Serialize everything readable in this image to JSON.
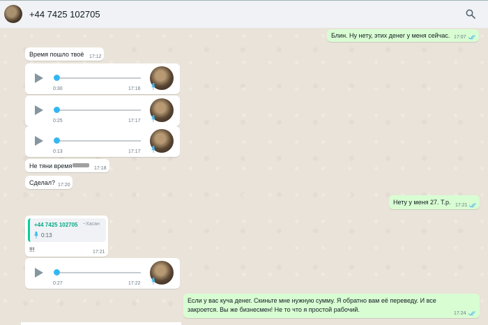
{
  "header": {
    "contact": "+44 7425 102705",
    "search_icon": "search-icon"
  },
  "colors": {
    "incoming": "#ffffff",
    "outgoing": "#d9fdd3",
    "read_ticks": "#53bdeb",
    "quote_bar": "#06cf9c"
  },
  "messages": {
    "m1": {
      "text": "Блин. Ну нету, этих денег у меня сейчас.",
      "time": "17:07"
    },
    "m2": {
      "text": "Время пошло твоё",
      "time": "17:12"
    },
    "v1": {
      "duration": "0:30",
      "time": "17:16"
    },
    "v2": {
      "duration": "0:25",
      "time": "17:17"
    },
    "v3": {
      "duration": "0:13",
      "time": "17:17"
    },
    "m3": {
      "text": "Не тяни время",
      "time": "17:18"
    },
    "m4": {
      "text": "Сделал?",
      "time": "17:20"
    },
    "m5": {
      "text": "Нету у меня 27. Т.р.",
      "time": "17:21"
    },
    "q1": {
      "quote_name": "+44 7425 102705",
      "quote_alias": "~Хасан",
      "quote_duration": "0:13",
      "text": "!!!",
      "time": "17:21"
    },
    "v4": {
      "duration": "0:27",
      "time": "17:22"
    },
    "m6": {
      "line1": "Если у вас куча денег. Скиньте мне нужную сумму. Я обратно вам её переведу. И все",
      "line2": "закроется. Вы же бизнесмен! Не то что я простой рабочий.",
      "time": "17:24"
    }
  }
}
